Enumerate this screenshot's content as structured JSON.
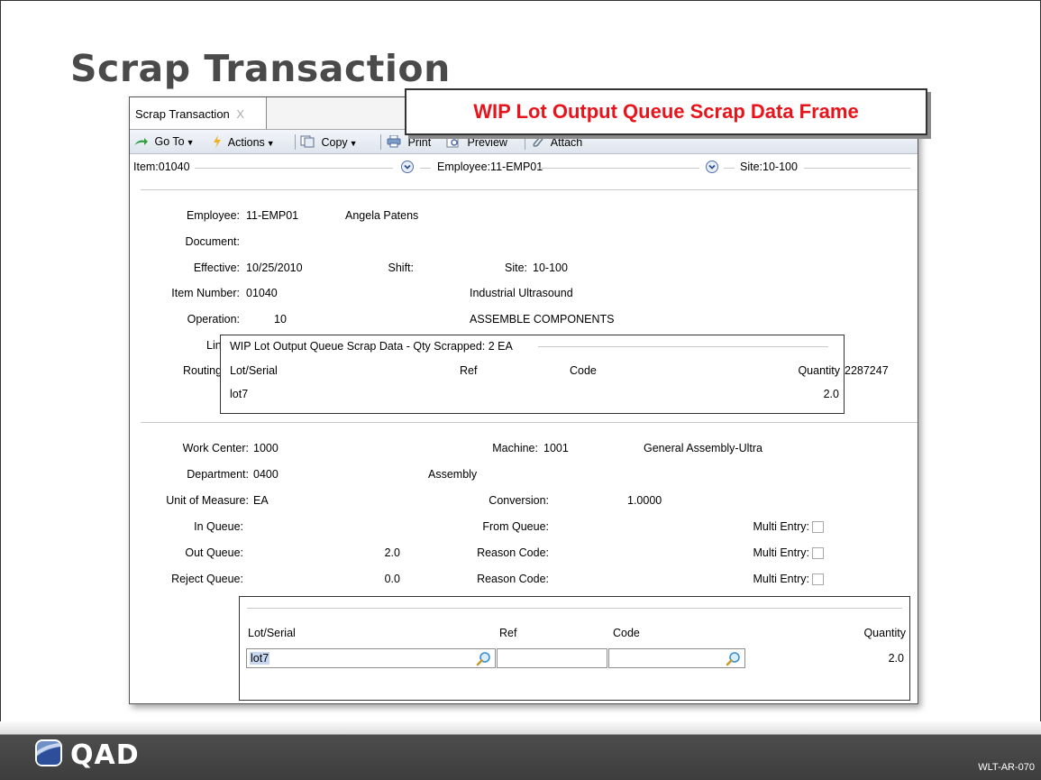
{
  "slide": {
    "title": "Scrap Transaction",
    "callout": "WIP Lot Output Queue Scrap Data Frame",
    "logo_text": "QAD",
    "footer_code": "WLT-AR-070"
  },
  "window": {
    "tab_label": "Scrap Transaction",
    "tab_close": "X"
  },
  "toolbar": {
    "goto": "Go To",
    "actions": "Actions",
    "copy": "Copy",
    "print": "Print",
    "preview": "Preview",
    "attach": "Attach"
  },
  "header_selectors": {
    "item": "Item:01040",
    "employee": "Employee:11-EMP01",
    "site": "Site:10-100"
  },
  "upper_form": {
    "employee_label": "Employee:",
    "employee_value": "11-EMP01",
    "employee_name": "Angela Patens",
    "document_label": "Document:",
    "effective_label": "Effective:",
    "effective_value": "10/25/2010",
    "shift_label": "Shift:",
    "site_label": "Site:",
    "site_value": "10-100",
    "item_number_label": "Item Number:",
    "item_number_value": "01040",
    "item_description": "Industrial Ultrasound",
    "operation_label": "Operation:",
    "operation_value": "10",
    "operation_description": "ASSEMBLE COMPONENTS",
    "line_label_partial": "Lin",
    "routing_label_partial": "Routing",
    "routing_value_partial": "2287247"
  },
  "popup": {
    "title": "WIP Lot Output Queue Scrap Data - Qty Scrapped: 2 EA",
    "columns": [
      "Lot/Serial",
      "Ref",
      "Code",
      "Quantity"
    ],
    "rows": [
      {
        "lot": "lot7",
        "ref": "",
        "code": "",
        "quantity": "2.0"
      }
    ]
  },
  "lower_form": {
    "work_center_label": "Work Center:",
    "work_center_value": "1000",
    "machine_label": "Machine:",
    "machine_value": "1001",
    "work_center_description": "General Assembly-Ultra",
    "department_label": "Department:",
    "department_value": "0400",
    "department_description": "Assembly",
    "uom_label": "Unit of Measure:",
    "uom_value": "EA",
    "conversion_label": "Conversion:",
    "conversion_value": "1.0000",
    "in_queue_label": "In Queue:",
    "from_queue_label": "From Queue:",
    "multi_entry_label": "Multi Entry:",
    "out_queue_label": "Out Queue:",
    "out_queue_value": "2.0",
    "reason_code_label": "Reason Code:",
    "reject_queue_label": "Reject Queue:",
    "reject_queue_value": "0.0"
  },
  "entry_grid": {
    "columns": [
      "Lot/Serial",
      "Ref",
      "Code",
      "Quantity"
    ],
    "lot_value": "lot7",
    "ref_value": "",
    "code_value": "",
    "quantity_value": "2.0"
  },
  "colors": {
    "callout_text": "#e8141b",
    "title_text": "#4a4a4a",
    "footer_bg": "#3d3d3d",
    "toolbar_bg": "#e6ebf2",
    "selection": "#c7d7ef"
  }
}
